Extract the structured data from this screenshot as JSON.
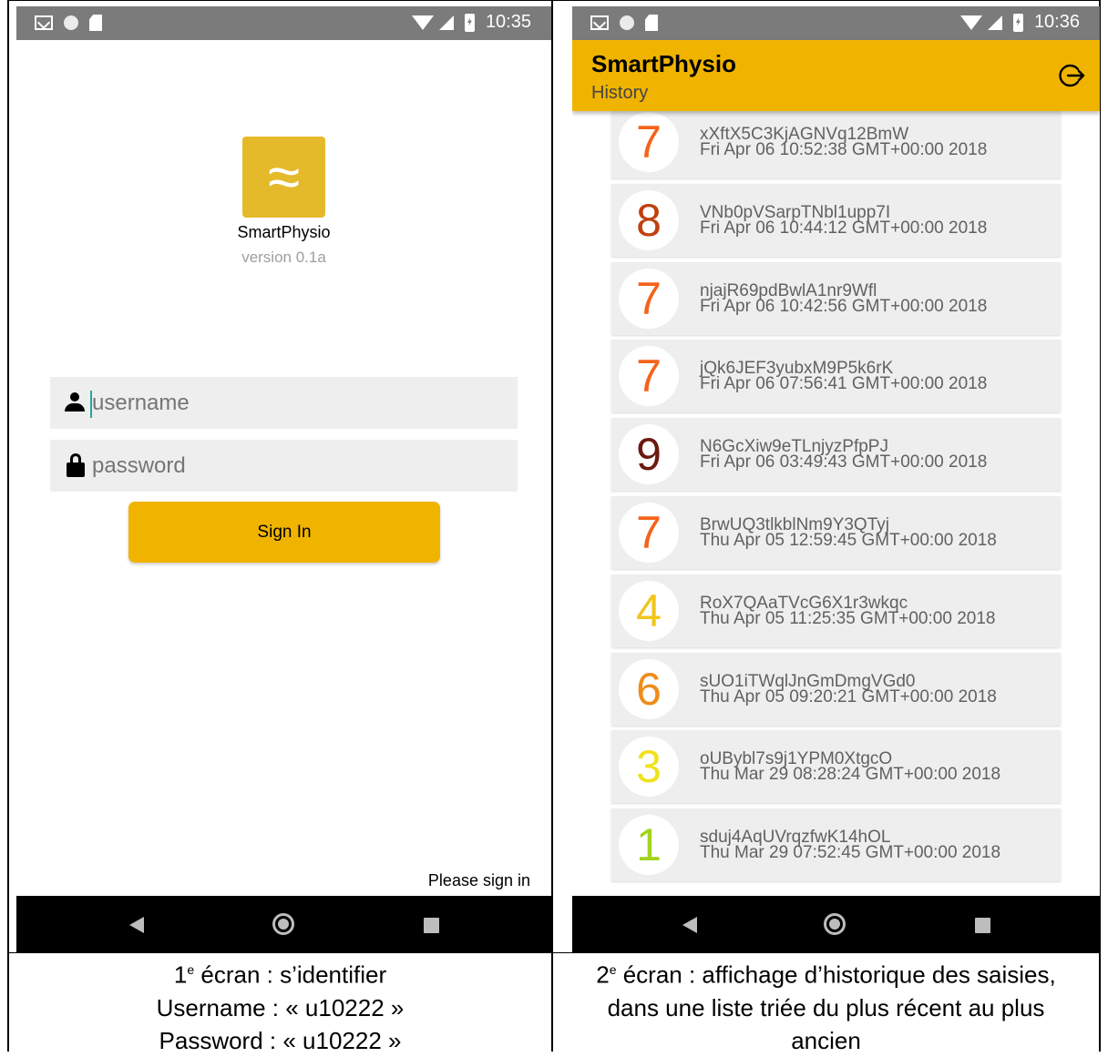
{
  "left_screen": {
    "status": {
      "time": "10:35"
    },
    "app_name": "SmartPhysio",
    "version": "version 0.1a",
    "username_placeholder": "username",
    "password_placeholder": "password",
    "signin_label": "Sign In",
    "footer_message": "Please sign in"
  },
  "right_screen": {
    "status": {
      "time": "10:36"
    },
    "title": "SmartPhysio",
    "subtitle": "History",
    "entries": [
      {
        "score": "7",
        "color": "#f4631b",
        "id": "xXftX5C3KjAGNVq12BmW",
        "date": "Fri Apr 06 10:52:38 GMT+00:00 2018"
      },
      {
        "score": "8",
        "color": "#c0410f",
        "id": "VNb0pVSarpTNbl1upp7I",
        "date": "Fri Apr 06 10:44:12 GMT+00:00 2018"
      },
      {
        "score": "7",
        "color": "#f4631b",
        "id": "njajR69pdBwlA1nr9Wfl",
        "date": "Fri Apr 06 10:42:56 GMT+00:00 2018"
      },
      {
        "score": "7",
        "color": "#f4631b",
        "id": "jQk6JEF3yubxM9P5k6rK",
        "date": "Fri Apr 06 07:56:41 GMT+00:00 2018"
      },
      {
        "score": "9",
        "color": "#6b1a10",
        "id": "N6GcXiw9eTLnjyzPfpPJ",
        "date": "Fri Apr 06 03:49:43 GMT+00:00 2018"
      },
      {
        "score": "7",
        "color": "#f4631b",
        "id": "BrwUQ3tlkblNm9Y3QTyj",
        "date": "Thu Apr 05 12:59:45 GMT+00:00 2018"
      },
      {
        "score": "4",
        "color": "#f2c51b",
        "id": "RoX7QAaTVcG6X1r3wkqc",
        "date": "Thu Apr 05 11:25:35 GMT+00:00 2018"
      },
      {
        "score": "6",
        "color": "#f08c1a",
        "id": "sUO1iTWqlJnGmDmgVGd0",
        "date": "Thu Apr 05 09:20:21 GMT+00:00 2018"
      },
      {
        "score": "3",
        "color": "#f0e21c",
        "id": "oUBybl7s9j1YPM0XtgcO",
        "date": "Thu Mar 29 08:28:24 GMT+00:00 2018"
      },
      {
        "score": "1",
        "color": "#a3d31b",
        "id": "sduj4AqUVrqzfwK14hOL",
        "date": "Thu Mar 29 07:52:45 GMT+00:00 2018"
      }
    ]
  },
  "captions": {
    "left": {
      "num": "1",
      "sup": "e",
      "line1": " écran : s’identifier",
      "line2": "Username : « u10222 »",
      "line3": "Password : « u10222 »"
    },
    "right": {
      "num": "2",
      "sup": "e",
      "line1": " écran : affichage d’historique des saisies,",
      "line2": "dans une liste triée du plus récent au plus",
      "line3": "ancien"
    }
  }
}
